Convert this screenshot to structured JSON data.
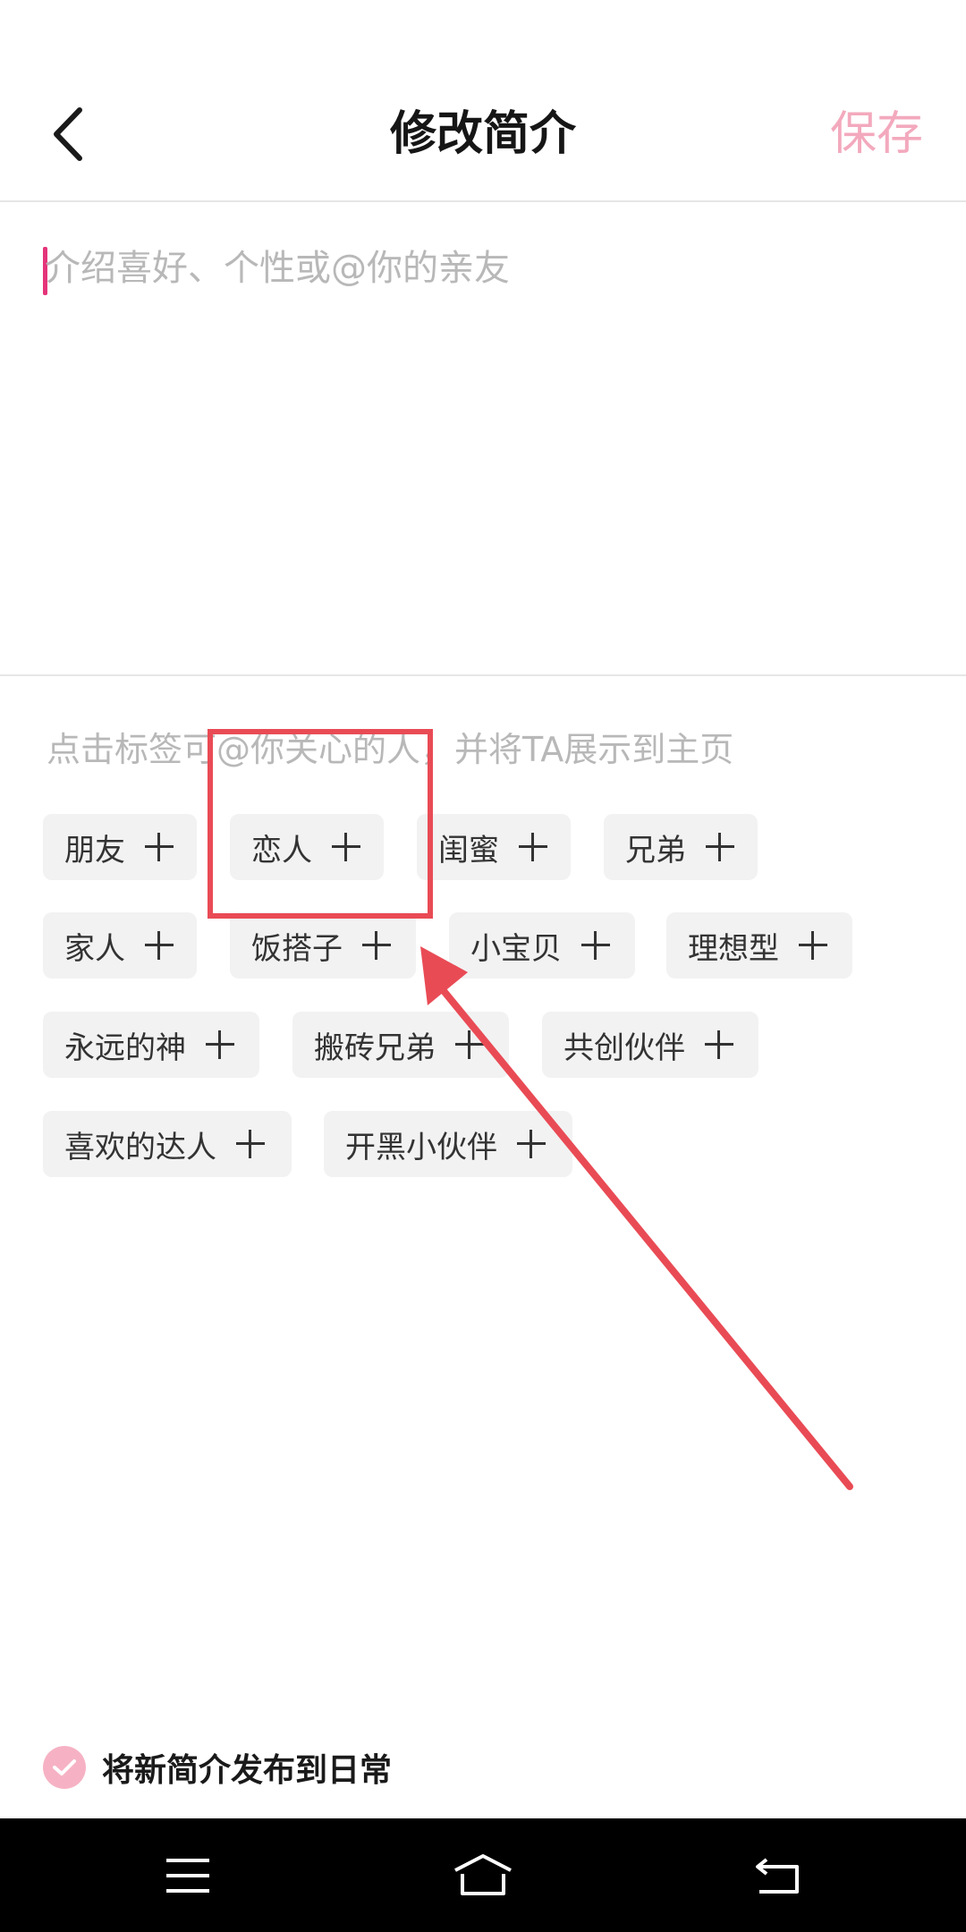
{
  "header": {
    "back_icon": "chevron-left-icon",
    "title": "修改简介",
    "save_label": "保存",
    "save_color": "#f3a9bd"
  },
  "intro": {
    "value": "",
    "placeholder": "介绍喜好、个性或@你的亲友",
    "cursor_color": "#e5347a"
  },
  "tags_section": {
    "hint": "点击标签可@你关心的人，并将TA展示到主页",
    "tags": [
      {
        "label": "朋友"
      },
      {
        "label": "恋人"
      },
      {
        "label": "闺蜜"
      },
      {
        "label": "兄弟"
      },
      {
        "label": "家人"
      },
      {
        "label": "饭搭子"
      },
      {
        "label": "小宝贝"
      },
      {
        "label": "理想型"
      },
      {
        "label": "永远的神"
      },
      {
        "label": "搬砖兄弟"
      },
      {
        "label": "共创伙伴"
      },
      {
        "label": "喜欢的达人"
      },
      {
        "label": "开黑小伙伴"
      }
    ]
  },
  "annotation": {
    "highlight_color": "#e94b55",
    "highlighted_tag": "恋人"
  },
  "footer": {
    "publish_label": "将新简介发布到日常",
    "publish_checked": true,
    "check_color": "#f6b2c4"
  },
  "navbar": {
    "buttons": [
      {
        "icon": "menu-icon"
      },
      {
        "icon": "home-icon"
      },
      {
        "icon": "back-icon"
      }
    ]
  }
}
